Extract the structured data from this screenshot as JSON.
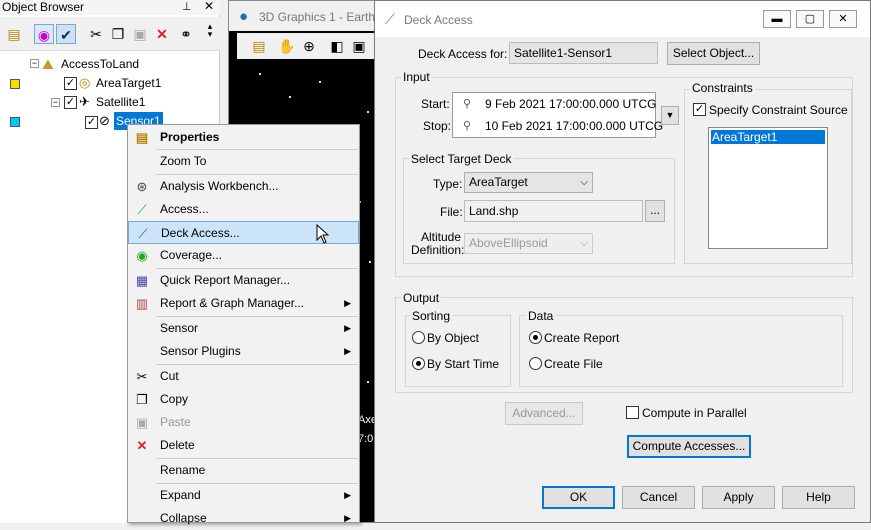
{
  "object_browser": {
    "title": "Object Browser",
    "tree": {
      "root": "AccessToLand",
      "area_target": "AreaTarget1",
      "satellite": "Satellite1",
      "sensor": "Sensor1"
    }
  },
  "graphics_window": {
    "title": "3D Graphics 1 - Earth",
    "overlay_text_1": "Axe",
    "overlay_text_2": "7:0"
  },
  "context_menu": {
    "items": [
      {
        "label": "Properties",
        "icon": "properties-icon"
      },
      {
        "label": "Zoom To"
      },
      {
        "label": "Analysis Workbench...",
        "icon": "workbench-icon"
      },
      {
        "label": "Access...",
        "icon": "access-icon"
      },
      {
        "label": "Deck Access...",
        "icon": "deck-access-icon"
      },
      {
        "label": "Coverage...",
        "icon": "coverage-icon"
      },
      {
        "label": "Quick Report Manager...",
        "icon": "report-icon"
      },
      {
        "label": "Report & Graph Manager...",
        "icon": "graph-icon"
      },
      {
        "label": "Sensor"
      },
      {
        "label": "Sensor Plugins"
      },
      {
        "label": "Cut",
        "icon": "cut-icon"
      },
      {
        "label": "Copy",
        "icon": "copy-icon"
      },
      {
        "label": "Paste",
        "icon": "paste-icon"
      },
      {
        "label": "Delete",
        "icon": "delete-icon"
      },
      {
        "label": "Rename"
      },
      {
        "label": "Expand"
      },
      {
        "label": "Collapse"
      }
    ]
  },
  "dialog": {
    "title": "Deck Access",
    "deck_access_for_label": "Deck Access for:",
    "deck_access_for_value": "Satellite1-Sensor1",
    "select_object_button": "Select Object...",
    "input_group": "Input",
    "start_label": "Start:",
    "start_value": "9 Feb 2021 17:00:00.000 UTCG",
    "stop_label": "Stop:",
    "stop_value": "10 Feb 2021 17:00:00.000 UTCG",
    "select_target_deck_group": "Select Target Deck",
    "type_label": "Type:",
    "type_value": "AreaTarget",
    "file_label": "File:",
    "file_value": "Land.shp",
    "browse_button": "...",
    "altitude_label_1": "Altitude",
    "altitude_label_2": "Definition:",
    "altitude_value": "AboveEllipsoid",
    "constraints_group": "Constraints",
    "specify_constraint_source": "Specify Constraint Source",
    "constraint_list": [
      "AreaTarget1"
    ],
    "output_group": "Output",
    "sorting_group": "Sorting",
    "by_object": "By Object",
    "by_start_time": "By Start Time",
    "data_group": "Data",
    "create_report": "Create Report",
    "create_file": "Create File",
    "advanced_button": "Advanced...",
    "compute_in_parallel": "Compute in Parallel",
    "compute_accesses_button": "Compute Accesses...",
    "ok_button": "OK",
    "cancel_button": "Cancel",
    "apply_button": "Apply",
    "help_button": "Help"
  },
  "colors": {
    "accent": "#0078d7",
    "selection": "#0078d7",
    "menu_highlight": "#cce4f7"
  }
}
